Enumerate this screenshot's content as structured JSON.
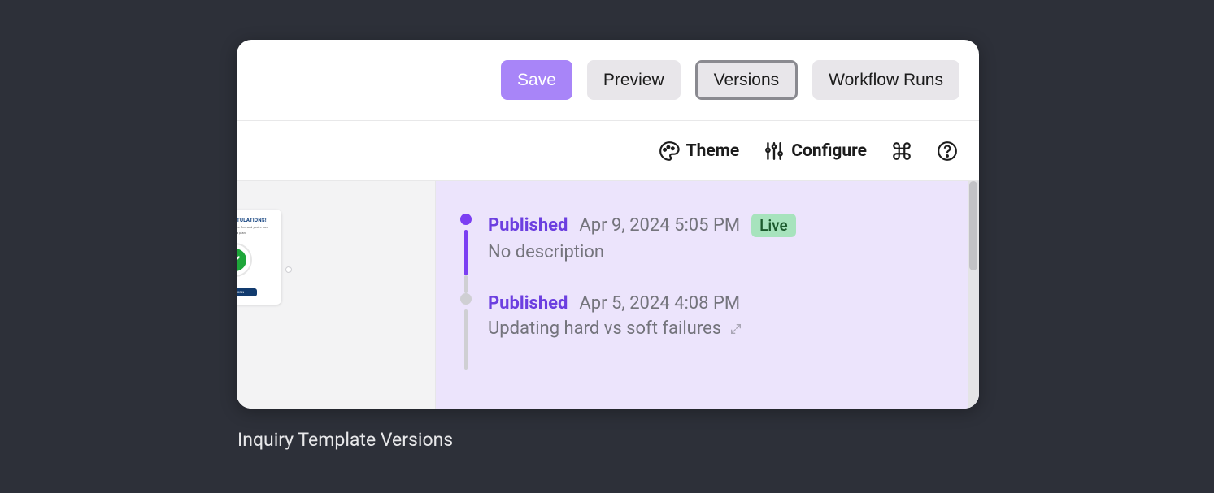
{
  "toolbar": {
    "save": "Save",
    "preview": "Preview",
    "versions": "Versions",
    "workflow_runs": "Workflow Runs"
  },
  "subtoolbar": {
    "theme": "Theme",
    "configure": "Configure"
  },
  "preview_card": {
    "title": "TULATIONS!",
    "subtitle1": "ve fled and you're now",
    "subtitle2": "a plan!",
    "button": "E TO LOGIN"
  },
  "versions": [
    {
      "status": "Published",
      "date": "Apr 9, 2024 5:05 PM",
      "live": "Live",
      "description": "No description",
      "active": true
    },
    {
      "status": "Published",
      "date": "Apr 5, 2024 4:08 PM",
      "description": "Updating hard vs soft failures",
      "active": false,
      "expandable": true
    }
  ],
  "caption": "Inquiry Template Versions"
}
